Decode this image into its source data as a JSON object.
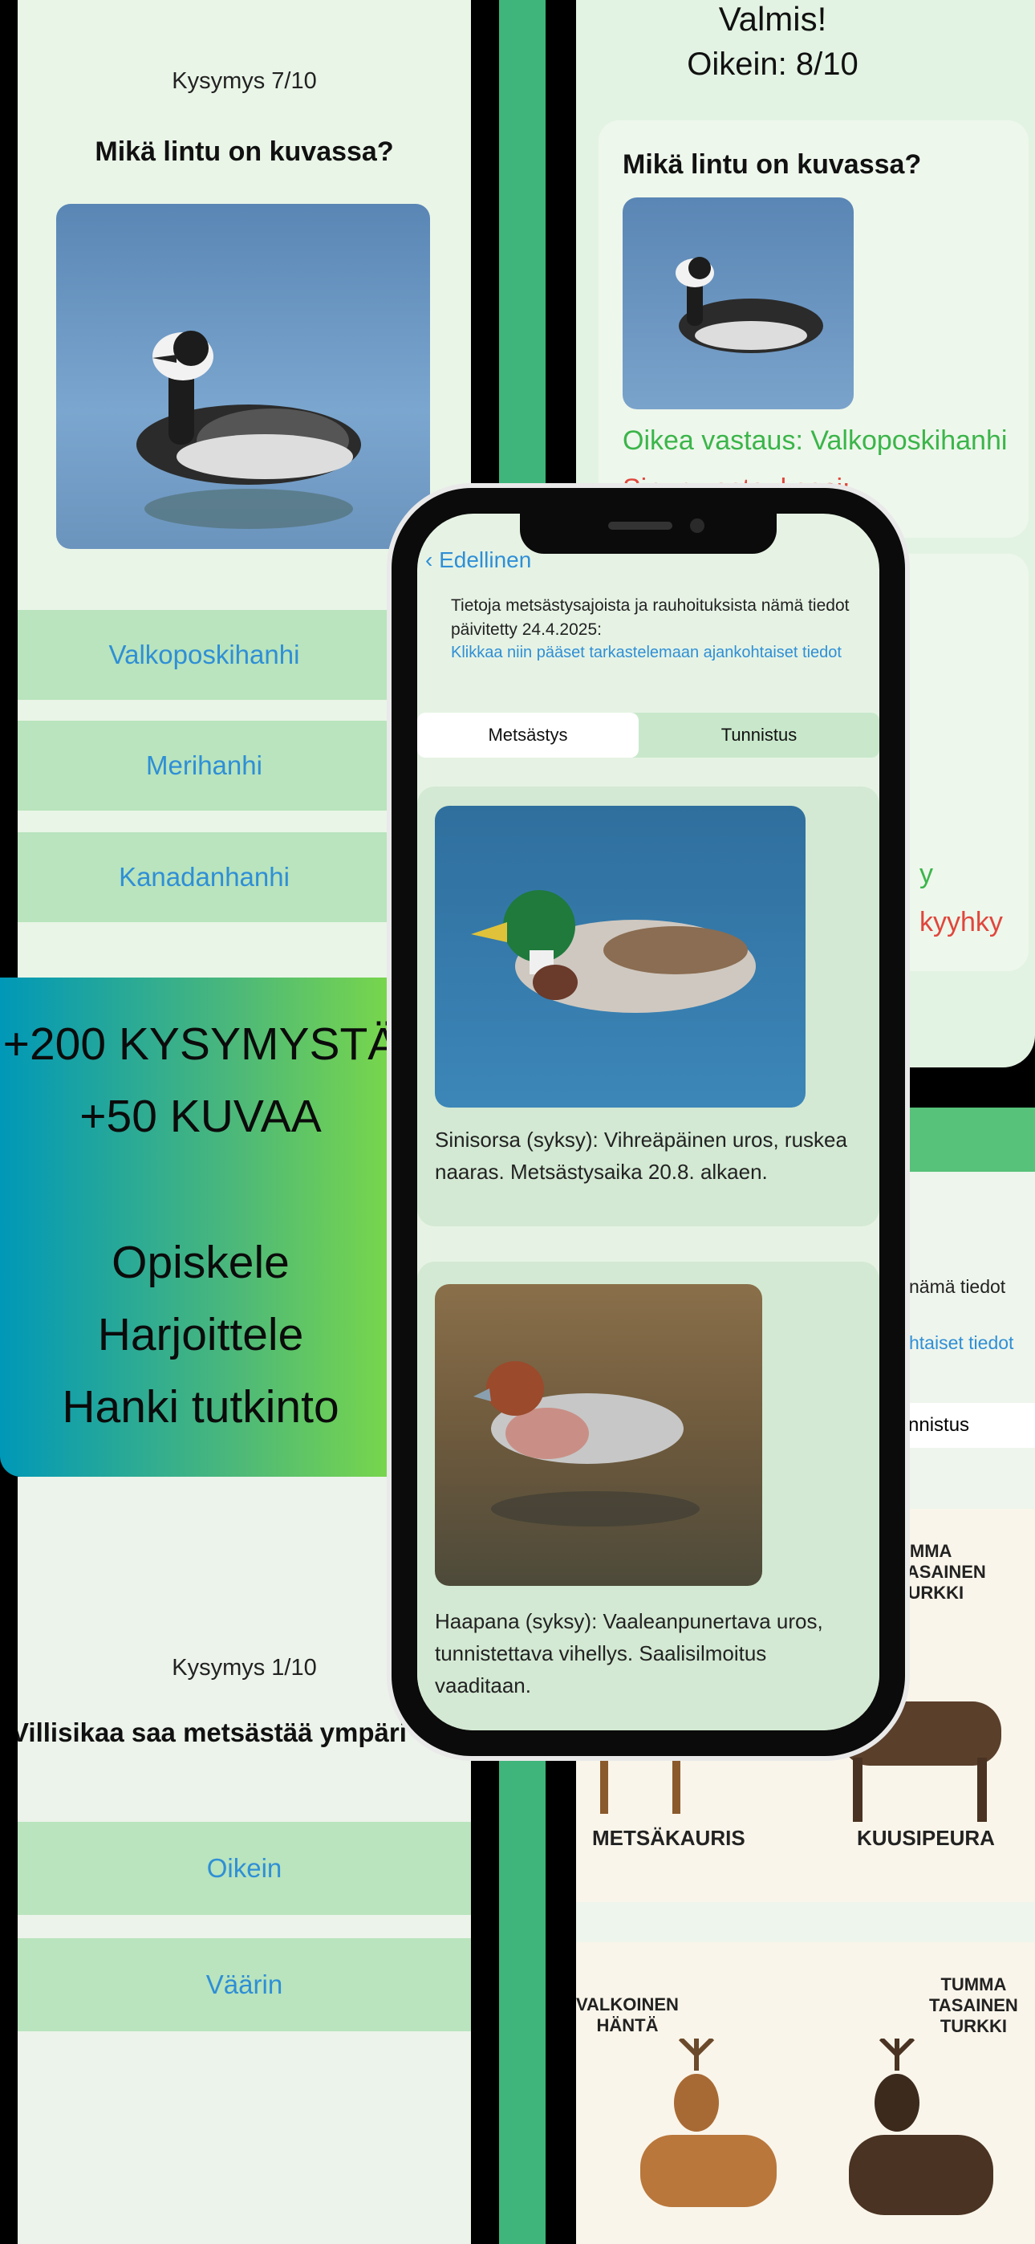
{
  "left_quiz": {
    "question_counter": "Kysymys 7/10",
    "question": "Mikä lintu on kuvassa?",
    "answers": [
      "Valkoposkihanhi",
      "Merihanhi",
      "Kanadanhanhi"
    ]
  },
  "result_screen": {
    "status": "Valmis!",
    "score": "Oikein: 8/10",
    "question": "Mikä lintu on kuvassa?",
    "correct_answer": "Oikea vastaus: Valkoposkihanhi",
    "wrong_answer": "Sinun vastauksesi: Kanadanhanhi",
    "partial_y": "y",
    "partial_kyyhky": "kyyhky"
  },
  "promo": {
    "line1": "+200 KYSYMYSTÄ",
    "line2": "+50 KUVAA",
    "line3": "Opiskele",
    "line4": "Harjoittele",
    "line5": "Hanki tutkinto",
    "gradient_start": "#0098b8",
    "gradient_end": "#78d64b"
  },
  "phone": {
    "back_label": "Edellinen",
    "notice_text": "Tietoja metsästysajoista ja rauhoituksista nämä tiedot päivitetty 24.4.2025:",
    "notice_link": "Klikkaa niin pääset tarkastelemaan ajankohtaiset tiedot",
    "tabs": [
      "Metsästys",
      "Tunnistus"
    ],
    "selected_tab": "Metsästys",
    "cards": [
      {
        "caption": "Sinisorsa (syksy): Vihreäpäinen uros, ruskea naaras. Metsästysaika 20.8. alkaen."
      },
      {
        "caption": "Haapana (syksy): Vaaleanpunertava uros, tunnistettava vihellys. Saalisilmoitus vaaditaan."
      }
    ]
  },
  "bottom_quiz": {
    "question_counter": "Kysymys 1/10",
    "question": "Villisikaa saa metsästää ympäri vuo",
    "answers": [
      "Oikein",
      "Väärin"
    ]
  },
  "right_lower": {
    "notice_partial": "nämä tiedot",
    "link_partial": "htaiset tiedot",
    "tab_partial": "nnistus",
    "deer_labels": {
      "tumma_partial": "UMMA\nTASAINEN\nTURKKI",
      "metsakauris": "METSÄKAURIS",
      "kuusipeura": "KUUSIPEURA",
      "valkoinen_hanta": "VALKOINEN\nHÄNTÄ",
      "tumma_tasainen": "TUMMA\nTASAINEN\nTURKKI"
    }
  },
  "colors": {
    "screen_bg": "#eef5ec",
    "button_bg": "#b9e4bd",
    "button_text": "#2f8fd6",
    "correct": "#3bb54a",
    "wrong": "#e0463c",
    "green_strip": "#3fb57b"
  }
}
